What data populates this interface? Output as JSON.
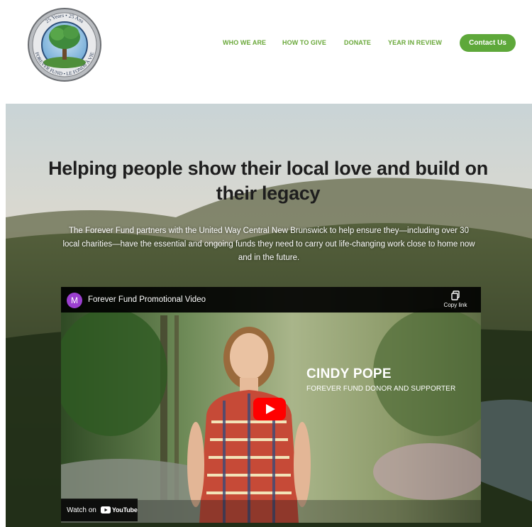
{
  "logo": {
    "ring_text_top": "25 Years • 25 Ans",
    "ring_text_bottom": "FOREVER FUND • LE FONDS À VIE"
  },
  "nav": {
    "items": [
      {
        "label": "WHO WE ARE"
      },
      {
        "label": "HOW TO GIVE"
      },
      {
        "label": "DONATE"
      },
      {
        "label": "YEAR IN REVIEW"
      }
    ],
    "contact_label": "Contact Us"
  },
  "hero": {
    "headline": "Helping people show their local love and build on their legacy",
    "body": "The Forever Fund partners with the United Way Central New Brunswick to help ensure they—including over 30 local charities—have the essential and ongoing funds they need to carry out life-changing work close to home now and in the future."
  },
  "video": {
    "channel_initial": "M",
    "title": "Forever Fund Promotional Video",
    "copy_link_label": "Copy link",
    "lower_third_name": "CINDY POPE",
    "lower_third_role": "FOREVER FUND DONOR AND SUPPORTER",
    "watch_on_label": "Watch on",
    "youtube_wordmark": "YouTube"
  },
  "colors": {
    "brand_green": "#5ea83a",
    "nav_green": "#6aa83a",
    "youtube_red": "#ff0000",
    "channel_purple": "#9b3fcf"
  }
}
